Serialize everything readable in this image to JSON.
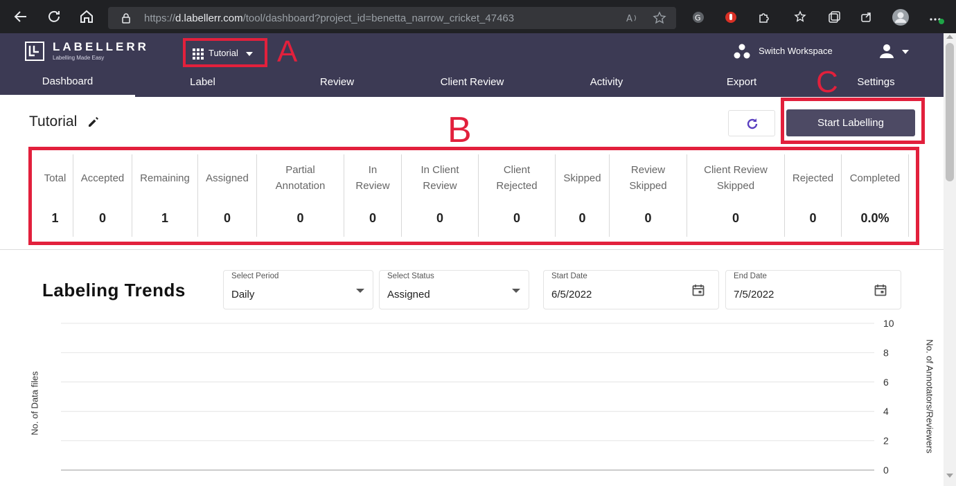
{
  "browser": {
    "url_host": "d.labellerr.com",
    "url_rest": "/tool/dashboard?project_id=benetta_narrow_cricket_47463",
    "url_prefix": "https://"
  },
  "header": {
    "logo_word": "LABELLERR",
    "logo_tag": "Labelling Made Easy",
    "project_name": "Tutorial",
    "switch_workspace": "Switch Workspace"
  },
  "tabs": [
    {
      "label": "Dashboard"
    },
    {
      "label": "Label"
    },
    {
      "label": "Review"
    },
    {
      "label": "Client Review"
    },
    {
      "label": "Activity"
    },
    {
      "label": "Export"
    },
    {
      "label": "Settings"
    }
  ],
  "annotations": {
    "a": "A",
    "b": "B",
    "c": "C"
  },
  "page": {
    "title": "Tutorial",
    "start_labelling": "Start Labelling"
  },
  "stats": [
    {
      "label": "Total",
      "value": "1"
    },
    {
      "label": "Accepted",
      "value": "0"
    },
    {
      "label": "Remaining",
      "value": "1"
    },
    {
      "label": "Assigned",
      "value": "0"
    },
    {
      "label": "Partial\nAnnotation",
      "value": "0"
    },
    {
      "label": "In\nReview",
      "value": "0"
    },
    {
      "label": "In Client\nReview",
      "value": "0"
    },
    {
      "label": "Client\nRejected",
      "value": "0"
    },
    {
      "label": "Skipped",
      "value": "0"
    },
    {
      "label": "Review\nSkipped",
      "value": "0"
    },
    {
      "label": "Client Review\nSkipped",
      "value": "0"
    },
    {
      "label": "Rejected",
      "value": "0"
    },
    {
      "label": "Completed",
      "value": "0.0%"
    }
  ],
  "trends": {
    "title": "Labeling Trends",
    "period_label": "Select Period",
    "period_value": "Daily",
    "status_label": "Select Status",
    "status_value": "Assigned",
    "start_label": "Start Date",
    "start_value": "6/5/2022",
    "end_label": "End Date",
    "end_value": "7/5/2022"
  },
  "chart_data": {
    "type": "line",
    "ylabel": "No. of Data files",
    "y2label": "No. of Annotators/Reviewers",
    "y2_ticks": [
      "10",
      "8",
      "6",
      "4",
      "2",
      "0"
    ],
    "y2lim": [
      0,
      10
    ],
    "grid": true,
    "series": []
  },
  "colors": {
    "header_bg": "#3c3a54",
    "accent": "#4d4a64",
    "annotation_red": "#e2203c"
  }
}
